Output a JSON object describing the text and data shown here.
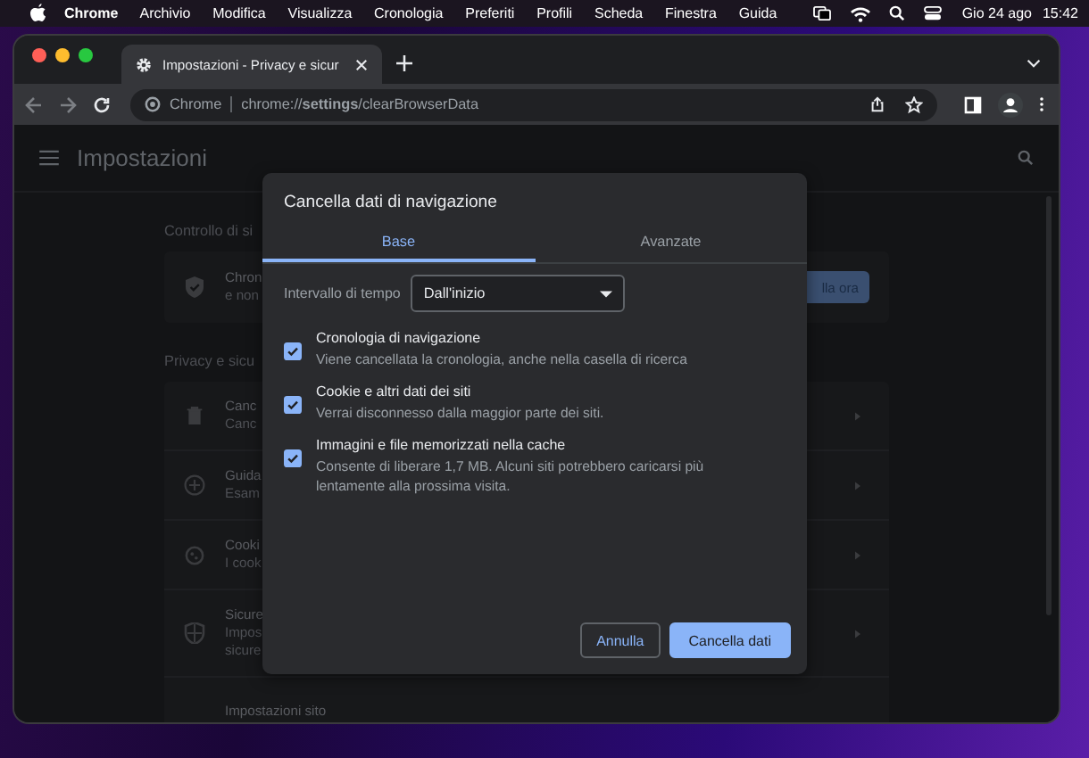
{
  "menubar": {
    "app_name": "Chrome",
    "menus": [
      "Archivio",
      "Modifica",
      "Visualizza",
      "Cronologia",
      "Preferiti",
      "Profili",
      "Scheda",
      "Finestra",
      "Guida"
    ],
    "date": "Gio 24 ago",
    "time": "15:42"
  },
  "browser": {
    "tab": {
      "title": "Impostazioni - Privacy e sicur",
      "selected": true
    },
    "address": {
      "site_label": "Chrome",
      "url": "chrome://**settings**/clearBrowserData"
    }
  },
  "settings": {
    "title": "Impostazioni",
    "safety_check": {
      "heading": "Controllo di si",
      "lines": [
        "Chron",
        "e non"
      ],
      "button": "lla ora"
    },
    "privacy": {
      "heading": "Privacy e sicu",
      "rows": [
        {
          "lines": [
            "Canc",
            "Canc"
          ]
        },
        {
          "lines": [
            "Guida",
            "Esam"
          ]
        },
        {
          "lines": [
            "Cooki",
            "I cook"
          ]
        },
        {
          "lines": [
            "Sicure",
            "Impos",
            "sicure"
          ]
        },
        {
          "lines": [
            "Impostazioni sito"
          ]
        }
      ]
    }
  },
  "dialog": {
    "title": "Cancella dati di navigazione",
    "tabs": [
      {
        "label": "Base",
        "selected": true
      },
      {
        "label": "Avanzate",
        "selected": false
      }
    ],
    "time_range": {
      "label": "Intervallo di tempo",
      "value": "Dall'inizio"
    },
    "items": [
      {
        "title": "Cronologia di navigazione",
        "description": "Viene cancellata la cronologia, anche nella casella di ricerca",
        "checked": true
      },
      {
        "title": "Cookie e altri dati dei siti",
        "description": "Verrai disconnesso dalla maggior parte dei siti.",
        "checked": true
      },
      {
        "title": "Immagini e file memorizzati nella cache",
        "description": "Consente di liberare 1,7 MB. Alcuni siti potrebbero caricarsi più lentamente alla prossima visita.",
        "checked": true
      }
    ],
    "buttons": [
      {
        "label": "Annulla",
        "kind": "secondary"
      },
      {
        "label": "Cancella dati",
        "kind": "primary"
      }
    ]
  }
}
